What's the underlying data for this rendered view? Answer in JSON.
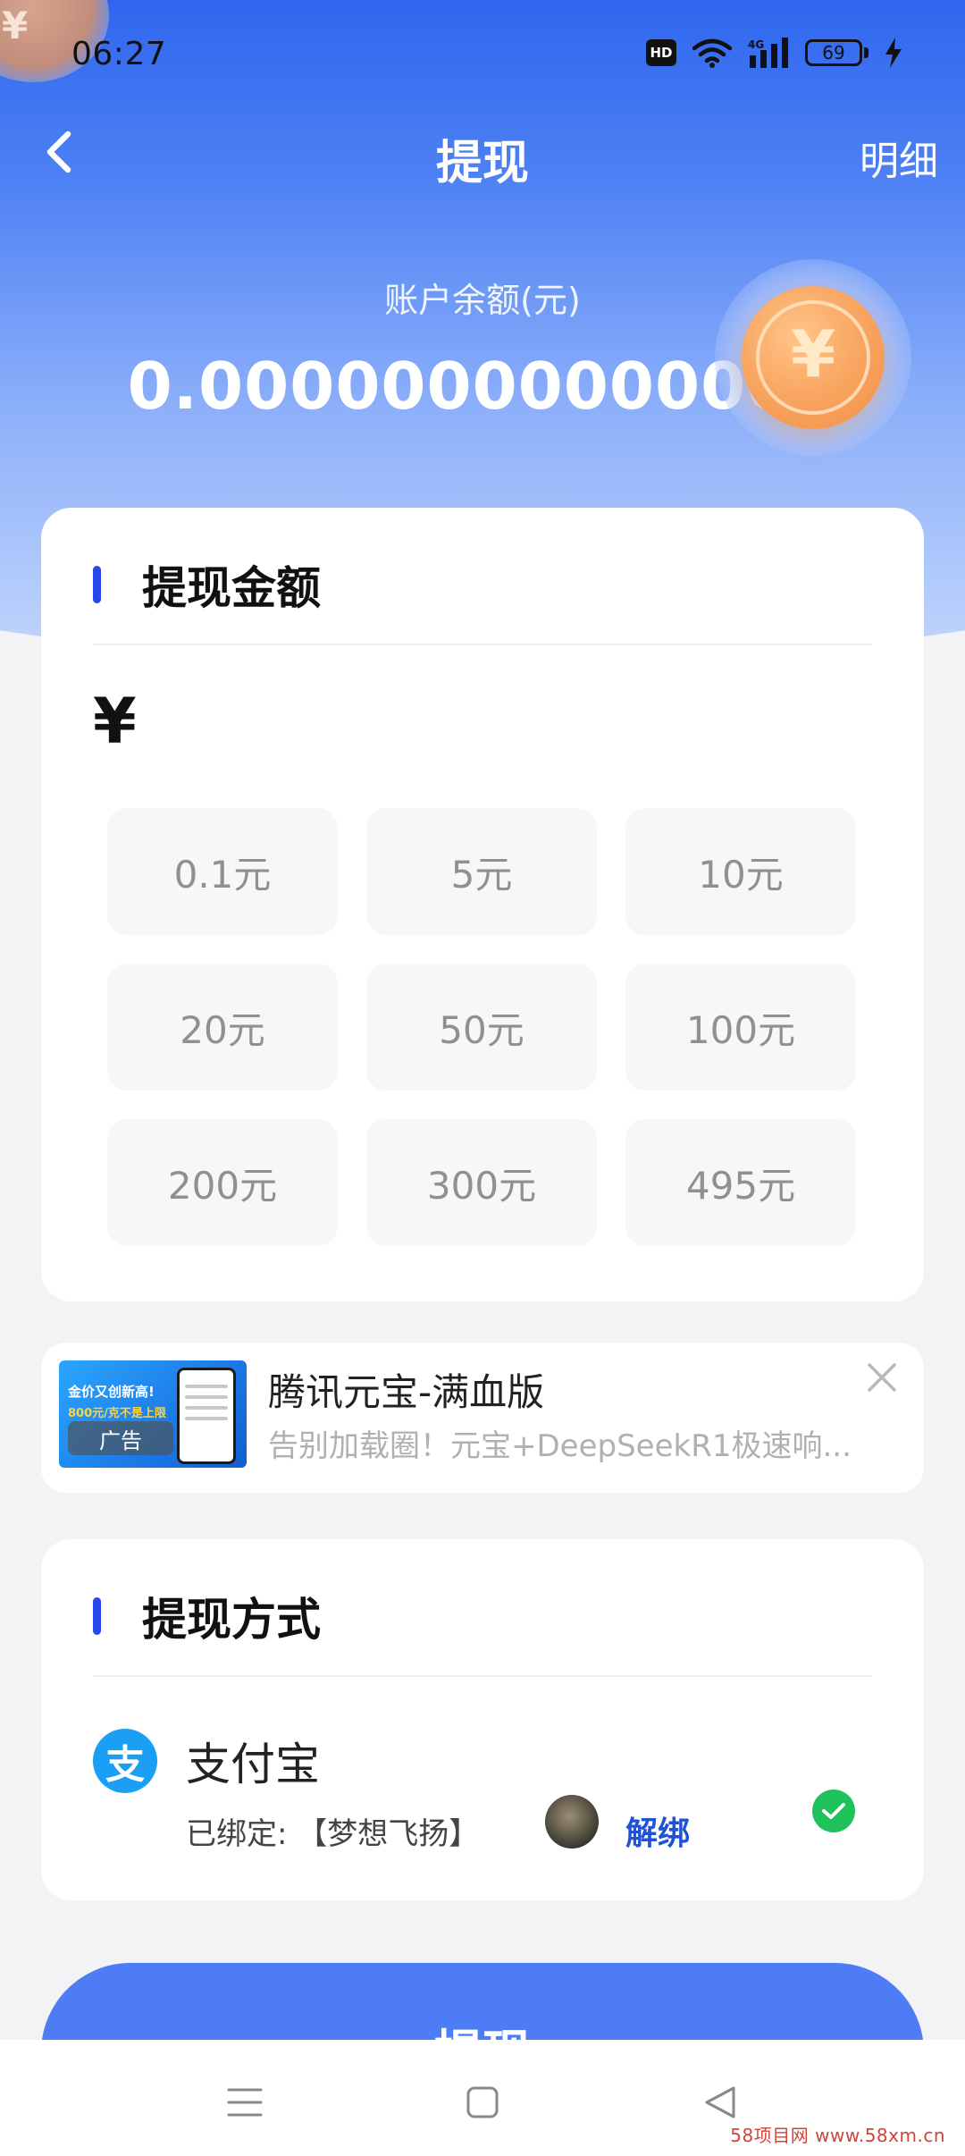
{
  "status_bar": {
    "time": "06:27",
    "hd_label": "HD",
    "network_label": "4G",
    "battery_level": "69"
  },
  "nav": {
    "title": "提现",
    "detail_label": "明细"
  },
  "balance": {
    "label": "账户余额(元)",
    "value": "0.00000000000000",
    "coin_symbol": "¥"
  },
  "amount_section": {
    "title": "提现金额",
    "currency_symbol": "¥",
    "options": [
      {
        "label": "0.1元"
      },
      {
        "label": "5元"
      },
      {
        "label": "10元"
      },
      {
        "label": "20元"
      },
      {
        "label": "50元"
      },
      {
        "label": "100元"
      },
      {
        "label": "200元"
      },
      {
        "label": "300元"
      },
      {
        "label": "495元"
      }
    ]
  },
  "ad": {
    "title": "腾讯元宝-满血版",
    "description": "告别加载圈！元宝+DeepSeekR1极速响...",
    "badge": "广告",
    "thumb_headline": "金价又创新高!",
    "thumb_sub": "800元/克不是上限"
  },
  "method_section": {
    "title": "提现方式",
    "provider_icon_char": "支",
    "provider_name": "支付宝",
    "bound_text": "已绑定: 【梦想飞扬】",
    "unbind_label": "解绑"
  },
  "primary_action": {
    "label": "提现"
  },
  "watermark": "58项目网 www.58xm.cn",
  "colors": {
    "accent": "#2a48e8",
    "button": "#4e7cf5",
    "link": "#1f52d6",
    "success": "#1fc15a",
    "alipay": "#1a9ff5"
  }
}
